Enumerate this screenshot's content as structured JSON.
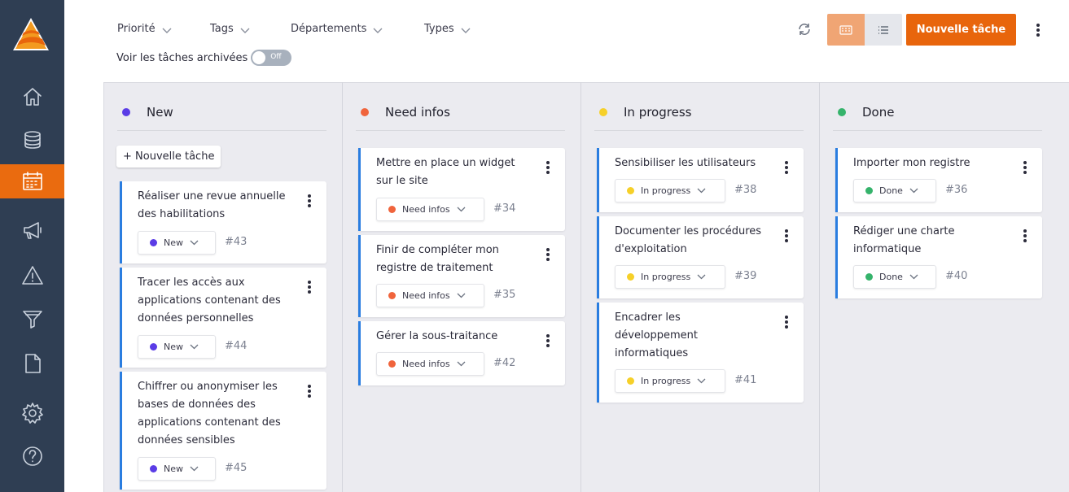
{
  "colors": {
    "sidebar": "#2f3e53",
    "accent": "#e8650c",
    "status_new": "#5a3ce6",
    "status_need_infos": "#f0643c",
    "status_in_progress": "#f6d029",
    "status_done": "#35b36b",
    "card_border": "#2a7de0"
  },
  "sidebar": {
    "logo": "logo-icon",
    "items": [
      {
        "icon": "home-icon"
      },
      {
        "icon": "database-icon"
      },
      {
        "icon": "calendar-icon",
        "active": true
      },
      {
        "icon": "megaphone-icon"
      },
      {
        "icon": "warning-icon"
      },
      {
        "icon": "filter-icon"
      },
      {
        "icon": "document-icon"
      },
      {
        "icon": "gear-icon"
      },
      {
        "icon": "help-icon"
      }
    ]
  },
  "toolbar": {
    "filters": [
      "Priorité",
      "Tags",
      "Départements",
      "Types"
    ],
    "archive_label": "Voir les tâches archivées",
    "archive_toggle": "Off",
    "new_task_label": "Nouvelle tâche"
  },
  "board": {
    "add_task_label": "+ Nouvelle tâche",
    "columns": [
      {
        "title": "New",
        "cards": [
          {
            "title": "Réaliser une revue annuelle des habilitations",
            "status": "New",
            "id": "#43"
          },
          {
            "title": "Tracer les accès aux applications contenant des données personnelles",
            "status": "New",
            "id": "#44"
          },
          {
            "title": "Chiffrer ou anonymiser les bases de données des applications contenant des données sensibles",
            "status": "New",
            "id": "#45"
          }
        ]
      },
      {
        "title": "Need infos",
        "cards": [
          {
            "title": "Mettre en place un widget sur le site",
            "status": "Need infos",
            "id": "#34"
          },
          {
            "title": "Finir de compléter mon registre de traitement",
            "status": "Need infos",
            "id": "#35"
          },
          {
            "title": "Gérer la sous-traitance",
            "status": "Need infos",
            "id": "#42"
          }
        ]
      },
      {
        "title": "In progress",
        "cards": [
          {
            "title": "Sensibiliser les utilisateurs",
            "status": "In progress",
            "id": "#38"
          },
          {
            "title": "Documenter les procédures d'exploitation",
            "status": "In progress",
            "id": "#39"
          },
          {
            "title": "Encadrer les développement informatiques",
            "status": "In progress",
            "id": "#41"
          }
        ]
      },
      {
        "title": "Done",
        "cards": [
          {
            "title": "Importer mon registre",
            "status": "Done",
            "id": "#36"
          },
          {
            "title": "Rédiger une charte informatique",
            "status": "Done",
            "id": "#40"
          }
        ]
      }
    ]
  }
}
